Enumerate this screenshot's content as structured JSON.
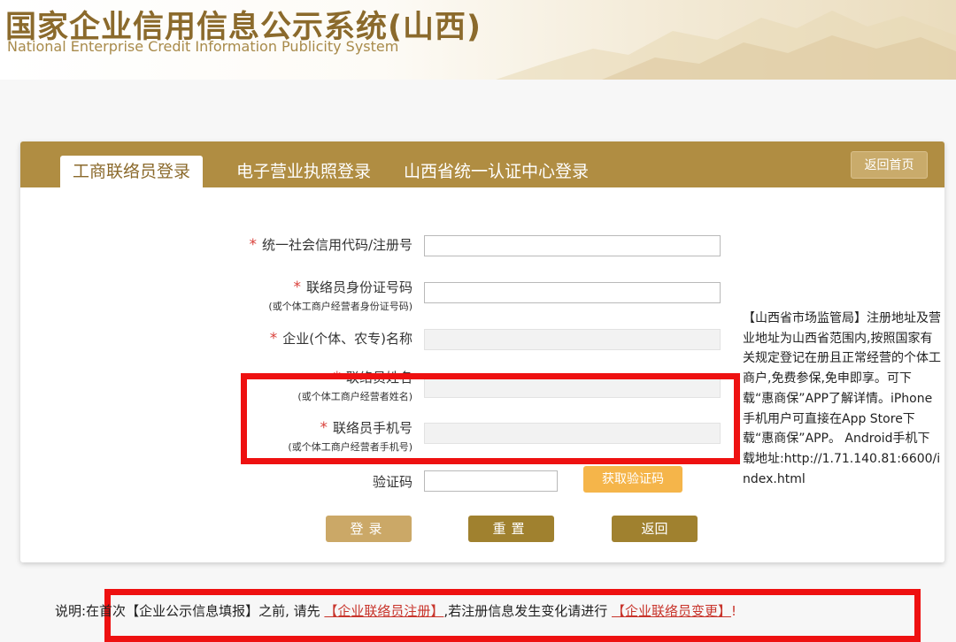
{
  "header": {
    "title": "国家企业信用信息公示系统(山西)",
    "subtitle": "National Enterprise Credit Information Publicity System"
  },
  "tabs": [
    {
      "label": "工商联络员登录",
      "active": true
    },
    {
      "label": "电子营业执照登录",
      "active": false
    },
    {
      "label": "山西省统一认证中心登录",
      "active": false
    }
  ],
  "home_button": "返回首页",
  "form": {
    "credit_code": {
      "label": "统一社会信用代码/注册号",
      "required": true,
      "value": ""
    },
    "id_number": {
      "label": "联络员身份证号码",
      "hint": "(或个体工商户经营者身份证号码)",
      "required": true,
      "value": ""
    },
    "enterprise_name": {
      "label": "企业(个体、农专)名称",
      "required": true,
      "value": ""
    },
    "contact_name": {
      "label": "联络员姓名",
      "hint": "(或个体工商户经营者姓名)",
      "required": true,
      "value": ""
    },
    "contact_phone": {
      "label": "联络员手机号",
      "hint": "(或个体工商户经营者手机号)",
      "required": true,
      "value": ""
    },
    "captcha": {
      "label": "验证码",
      "value": ""
    },
    "get_code_button": "获取验证码",
    "login_button": "登录",
    "reset_button": "重置",
    "back_button": "返回"
  },
  "side_note": "【山西省市场监管局】注册地址及营业地址为山西省范围内,按照国家有关规定登记在册且正常经营的个体工商户,免费参保,免申即享。可下载“惠商保”APP了解详情。iPhone手机用户可直接在App Store下载“惠商保”APP。 Android手机下载地址:http://1.71.140.81:6600/index.html",
  "footnote": {
    "prefix": "说明:在首次",
    "report": "【企业公示信息填报】",
    "middle": "之前, 请先",
    "register_link": "【企业联络员注册】",
    "middle2": ",若注册信息发生变化请进行",
    "change_link": "【企业联络员变更】",
    "suffix": "!"
  },
  "colors": {
    "brand": "#b08d42",
    "required_mark": "#d9403a",
    "highlight_box": "#ee1111",
    "sms_button": "#f5b54a"
  }
}
